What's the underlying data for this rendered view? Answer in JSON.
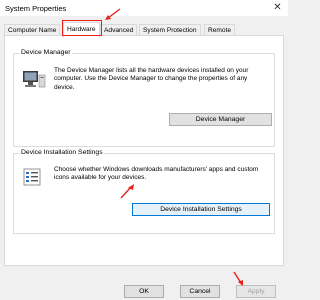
{
  "window": {
    "title": "System Properties",
    "close_glyph": "✕"
  },
  "tabs": [
    {
      "label": "Computer Name",
      "active": false
    },
    {
      "label": "Hardware",
      "active": true
    },
    {
      "label": "Advanced",
      "active": false
    },
    {
      "label": "System Protection",
      "active": false
    },
    {
      "label": "Remote",
      "active": false
    }
  ],
  "device_manager": {
    "group_label": "Device Manager",
    "description": "The Device Manager lists all the hardware devices installed on your computer. Use the Device Manager to change the properties of any device.",
    "button_label": "Device Manager",
    "icon": "computer-monitor-icon"
  },
  "device_installation": {
    "group_label": "Device Installation Settings",
    "description": "Choose whether Windows downloads manufacturers' apps and custom icons available for your devices.",
    "button_label": "Device Installation Settings",
    "icon": "checklist-icon"
  },
  "footer": {
    "ok_label": "OK",
    "cancel_label": "Cancel",
    "apply_label": "Apply"
  },
  "colors": {
    "highlight_red": "#e8211b",
    "focus_blue": "#0078d7"
  }
}
